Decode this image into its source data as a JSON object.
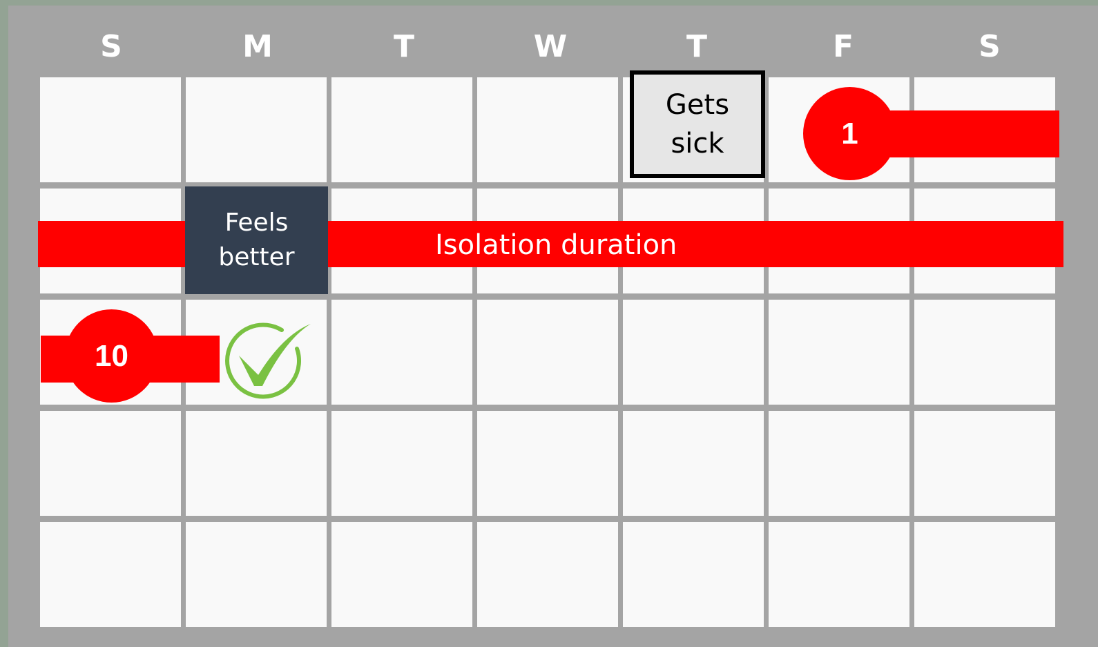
{
  "calendar": {
    "day_headers": [
      "S",
      "M",
      "T",
      "W",
      "T",
      "F",
      "S"
    ],
    "rows": 5
  },
  "events": {
    "gets_sick": {
      "line1": "Gets",
      "line2": "sick"
    },
    "feels_better": {
      "line1": "Feels",
      "line2": "better"
    },
    "isolation_label": "Isolation duration",
    "day_start": "1",
    "day_end": "10"
  },
  "icons": {
    "check": "check-circle-icon"
  },
  "colors": {
    "background": "#a4a4a4",
    "cell": "#f9f9f9",
    "isolation": "#ff0000",
    "feels_better": "#333f50",
    "check": "#7ac142"
  }
}
